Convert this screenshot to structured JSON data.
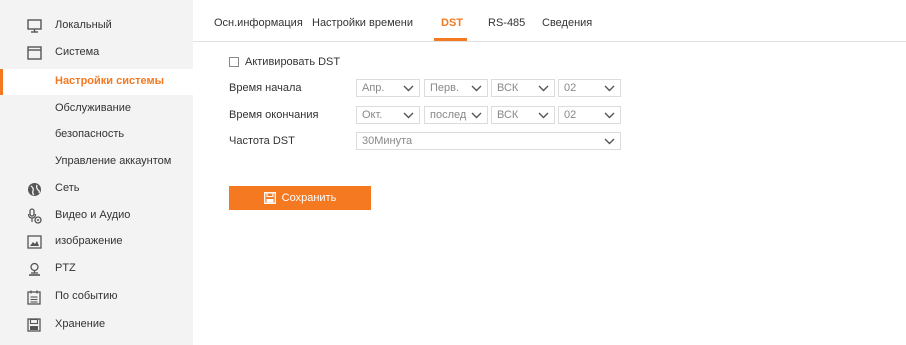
{
  "sidebar": {
    "items": [
      {
        "label": "Локальный",
        "icon": "monitor-icon"
      },
      {
        "label": "Система",
        "icon": "system-window-icon"
      },
      {
        "label": "Настройки системы",
        "active": true
      },
      {
        "label": "Обслуживание"
      },
      {
        "label": "безопасность"
      },
      {
        "label": "Управление аккаунтом"
      },
      {
        "label": "Сеть",
        "icon": "globe-icon"
      },
      {
        "label": "Видео и Аудио",
        "icon": "mic-video-icon"
      },
      {
        "label": "изображение",
        "icon": "image-icon"
      },
      {
        "label": "PTZ",
        "icon": "ptz-camera-icon"
      },
      {
        "label": "По событию",
        "icon": "calendar-event-icon"
      },
      {
        "label": "Хранение",
        "icon": "storage-disk-icon"
      }
    ]
  },
  "tabs": [
    {
      "label": "Осн.информация"
    },
    {
      "label": "Настройки времени"
    },
    {
      "label": "DST",
      "active": true
    },
    {
      "label": "RS-485"
    },
    {
      "label": "Сведения"
    }
  ],
  "form": {
    "enable_dst_label": "Активировать DST",
    "enable_dst_checked": false,
    "start_time_label": "Время начала",
    "end_time_label": "Время окончания",
    "dst_bias_label": "Частота DST",
    "start": {
      "month": "Апр.",
      "week": "Перв.",
      "day": "ВСК",
      "hour": "02"
    },
    "end": {
      "month": "Окт.",
      "week": "послед",
      "day": "ВСК",
      "hour": "02"
    },
    "bias": "30Минута"
  },
  "save_button": {
    "label": "Сохранить"
  },
  "colors": {
    "accent": "#f47920",
    "sidebar_bg": "#f3f3f3"
  }
}
